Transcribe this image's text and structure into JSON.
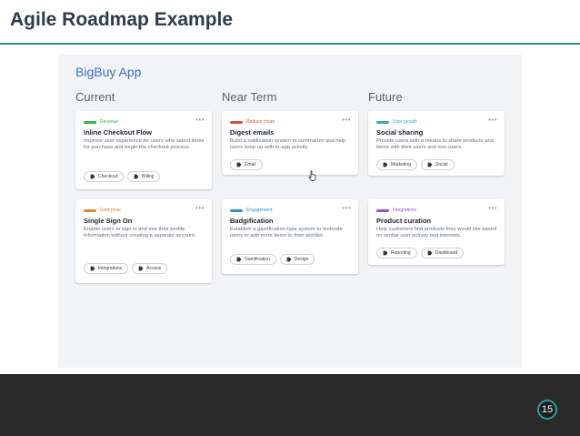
{
  "slide": {
    "title": "Agile Roadmap Example",
    "page_number": "15",
    "accent_color": "#2a8c8c"
  },
  "app": {
    "name": "BigBuy App",
    "columns": [
      {
        "header": "Current",
        "cards": [
          {
            "tag": "Revenue",
            "tag_color": "#3bb54a",
            "title": "Inline Checkout Flow",
            "description": "Improve user experience for users who select items for purchase and begin the checkout process.",
            "chips": [
              "Checkout",
              "Billing"
            ]
          },
          {
            "tag": "Enterprise",
            "tag_color": "#e08a2e",
            "title": "Single Sign On",
            "description": "Enable users to sign in and see their profile information without creating a separate account.",
            "chips": [
              "Integrations",
              "Access"
            ]
          }
        ]
      },
      {
        "header": "Near Term",
        "cards": [
          {
            "tag": "Reduce churn",
            "tag_color": "#d94a4a",
            "title": "Digest emails",
            "description": "Build a notification system to summarize and help users keep up with in-app activity.",
            "chips": [
              "Email"
            ]
          },
          {
            "tag": "Engagement",
            "tag_color": "#2f8fd8",
            "title": "Badgification",
            "description": "Establish a gamification-type system to motivate users to add more items to their wishlist.",
            "chips": [
              "Gamification",
              "Design"
            ]
          }
        ]
      },
      {
        "header": "Future",
        "cards": [
          {
            "tag": "User growth",
            "tag_color": "#2ab5b0",
            "title": "Social sharing",
            "description": "Provide users with a means to share products and items with their users and non-users.",
            "chips": [
              "Marketing",
              "Social"
            ]
          },
          {
            "tag": "Integrations",
            "tag_color": "#9b4fd6",
            "title": "Product curation",
            "description": "Help customers find products they would like based on similar user activity and interests.",
            "chips": [
              "Reporting",
              "Dashboard"
            ]
          }
        ]
      }
    ]
  },
  "icons": {
    "card_menu": "more-horizontal-icon",
    "chip": "tag-icon",
    "pointer": "hand-cursor-icon"
  }
}
